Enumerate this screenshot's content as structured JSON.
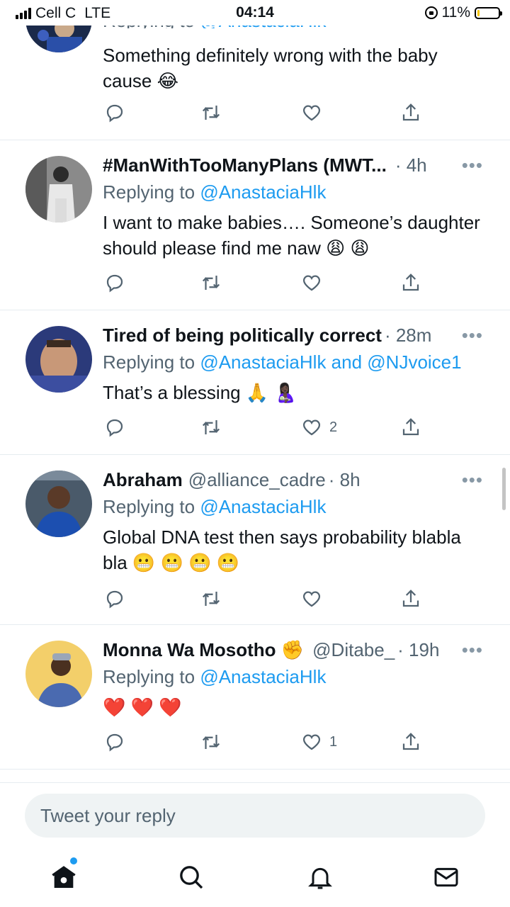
{
  "status_bar": {
    "carrier": "Cell C",
    "network": "LTE",
    "time": "04:14",
    "battery": "11%",
    "battery_level": 0.11
  },
  "tweets": [
    {
      "replying_prefix": "Replying to",
      "replying_to": "@AnastaciaHlk",
      "text": "Something definitely wrong with the baby cause 😂"
    },
    {
      "name": "#ManWithTooManyPlans (MWT...",
      "handle": "",
      "time": "· 4h",
      "replying_prefix": "Replying to",
      "replying_to": "@AnastaciaHlk",
      "text": "I want to make babies…. Someone’s daughter should please find me naw 😩 😩",
      "likes": ""
    },
    {
      "name": "Tired of being politically correct",
      "handle": "",
      "time": "· 28m",
      "replying_prefix": "Replying to",
      "replying_to": "@AnastaciaHlk and @NJvoice1",
      "text": "That’s a blessing 🙏 🤱🏿",
      "likes": "2"
    },
    {
      "name": "Abraham",
      "handle": "@alliance_cadre",
      "time": "· 8h",
      "replying_prefix": "Replying to",
      "replying_to": "@AnastaciaHlk",
      "text": "Global DNA test then says probability blabla bla 😬 😬 😬 😬",
      "likes": ""
    },
    {
      "name": "Monna Wa Mosotho ✊",
      "handle": "@Ditabe_",
      "time": "· 19h",
      "replying_prefix": "Replying to",
      "replying_to": "@AnastaciaHlk",
      "text": "❤️ ❤️ ❤️",
      "likes": "1"
    }
  ],
  "more_label": "•••",
  "reply_box": {
    "placeholder": "Tweet your reply"
  },
  "nav": {
    "items": [
      "home-icon",
      "search-icon",
      "notifications-icon",
      "messages-icon"
    ],
    "accent": "#1d9bf0"
  }
}
